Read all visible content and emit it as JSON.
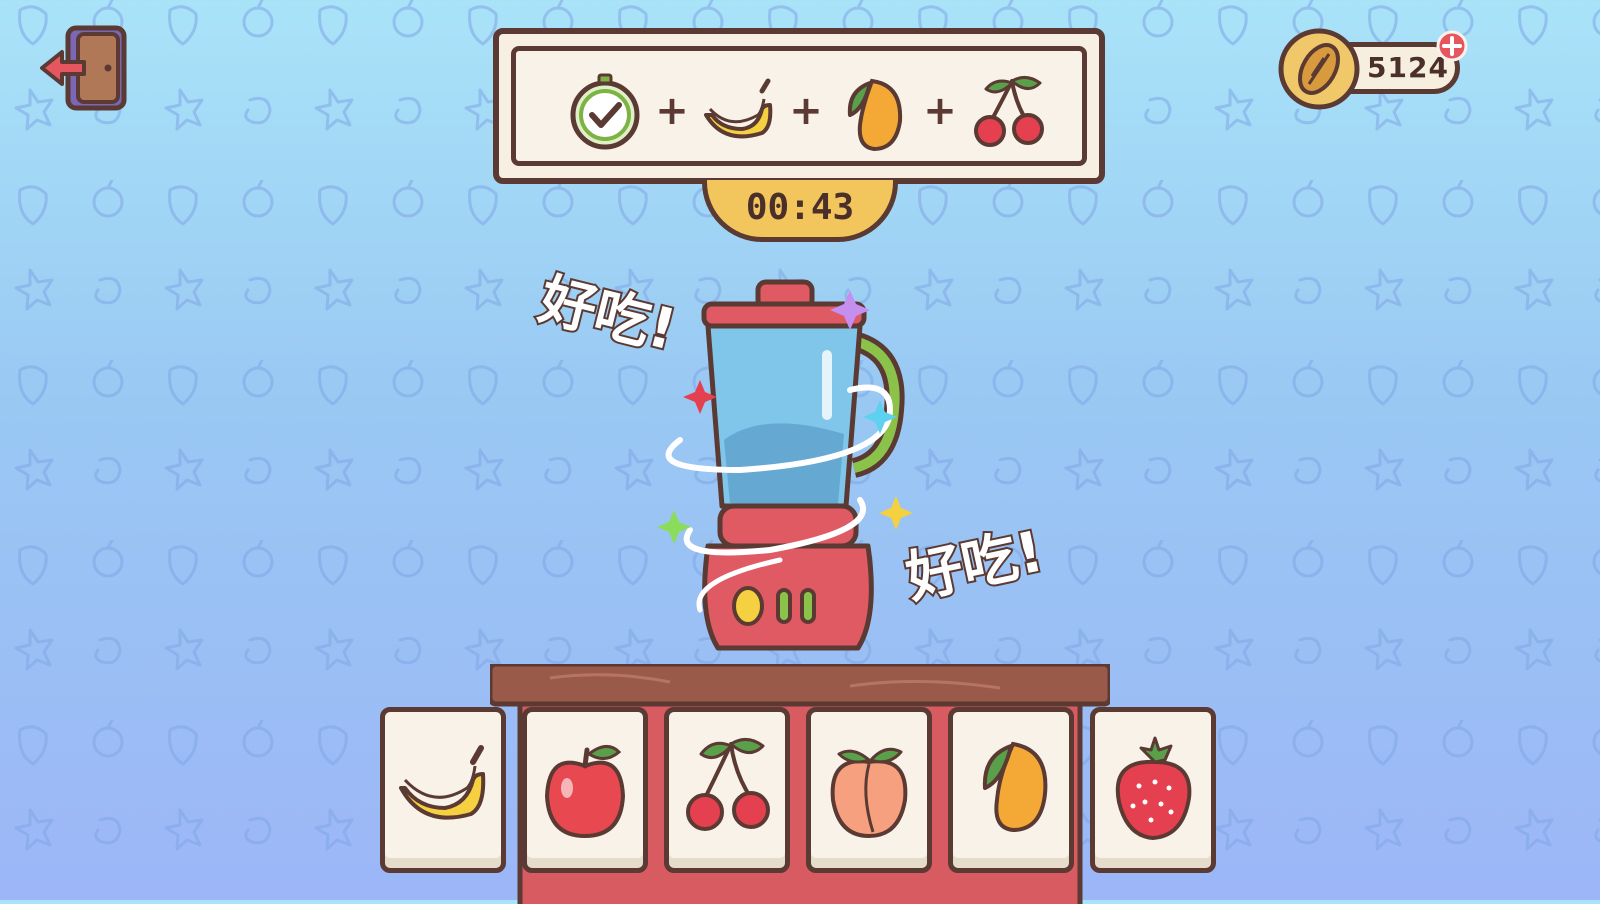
{
  "header": {
    "exit_icon": "exit-door-icon",
    "coins": "5124",
    "coin_icon": "seed-coin-icon",
    "add_coins_icon": "plus-icon"
  },
  "recipe": {
    "items": [
      {
        "icon": "check-stopwatch-icon",
        "status": "completed"
      },
      {
        "icon": "banana-icon"
      },
      {
        "icon": "mango-icon"
      },
      {
        "icon": "cherry-icon"
      }
    ],
    "separator": "+"
  },
  "timer": {
    "value": "00:43"
  },
  "exclamations": {
    "first": "好吃!",
    "second": "好吃!"
  },
  "cards": [
    {
      "icon": "banana-icon"
    },
    {
      "icon": "apple-icon"
    },
    {
      "icon": "cherry-icon"
    },
    {
      "icon": "peach-icon"
    },
    {
      "icon": "mango-icon"
    },
    {
      "icon": "strawberry-icon"
    }
  ],
  "colors": {
    "outline": "#5b3a33",
    "panel": "#f7efe2",
    "timer": "#f2c55d",
    "blender_base": "#e05a64",
    "blender_jar": "#79c3e6",
    "background_top": "#a9e3f8",
    "background_bottom": "#9cb6f7"
  }
}
